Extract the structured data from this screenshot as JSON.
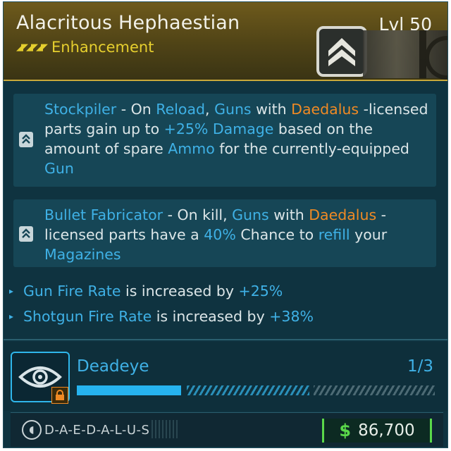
{
  "item": {
    "name": "Alacritous Hephaestian",
    "rarity": "Enhancement",
    "level": "Lvl 50",
    "rarity_color": "#e6cf2e",
    "emblem_icon": "chevron-emblem-icon"
  },
  "perks": [
    {
      "icon": "chevron-perk-icon",
      "segments": [
        {
          "text": "Stockpiler",
          "style": "blue"
        },
        {
          "text": " - On ",
          "style": "plain"
        },
        {
          "text": "Reload",
          "style": "blue"
        },
        {
          "text": ", ",
          "style": "plain"
        },
        {
          "text": "Guns",
          "style": "blue"
        },
        {
          "text": " with ",
          "style": "plain"
        },
        {
          "text": "Daedalus",
          "style": "orange"
        },
        {
          "text": " -licensed parts gain up to ",
          "style": "plain"
        },
        {
          "text": "+25% Damage",
          "style": "blue"
        },
        {
          "text": " based on the amount of spare ",
          "style": "plain"
        },
        {
          "text": "Ammo",
          "style": "blue"
        },
        {
          "text": " for the currently-equipped ",
          "style": "plain"
        },
        {
          "text": "Gun",
          "style": "blue"
        }
      ]
    },
    {
      "icon": "chevron-perk-icon",
      "segments": [
        {
          "text": "Bullet Fabricator",
          "style": "blue"
        },
        {
          "text": " - On kill, ",
          "style": "plain"
        },
        {
          "text": "Guns",
          "style": "blue"
        },
        {
          "text": " with ",
          "style": "plain"
        },
        {
          "text": "Daedalus",
          "style": "orange"
        },
        {
          "text": " -licensed parts have a ",
          "style": "plain"
        },
        {
          "text": "40%",
          "style": "blue"
        },
        {
          "text": " Chance to ",
          "style": "plain"
        },
        {
          "text": "refill",
          "style": "blue"
        },
        {
          "text": " your ",
          "style": "plain"
        },
        {
          "text": "Magazines",
          "style": "blue"
        }
      ]
    }
  ],
  "stats": [
    {
      "name": "Gun Fire Rate",
      "middle": " is increased by ",
      "value": "+25%"
    },
    {
      "name": "Shotgun Fire Rate",
      "middle": " is increased by ",
      "value": "+38%"
    }
  ],
  "class_mod": {
    "name": "Deadeye",
    "rank": "1/3",
    "progress_fraction": 0.33,
    "icon": "eye-target-icon",
    "lock_icon": "lock-icon"
  },
  "footer": {
    "manufacturer": "D-A-E-D-A-L-U-S",
    "currency_symbol": "$",
    "price": "86,700"
  },
  "colors": {
    "accent_blue": "#3fb1e6",
    "accent_orange": "#f08a24",
    "price_green": "#5ad84a",
    "header_gold": "#c9a93a"
  }
}
